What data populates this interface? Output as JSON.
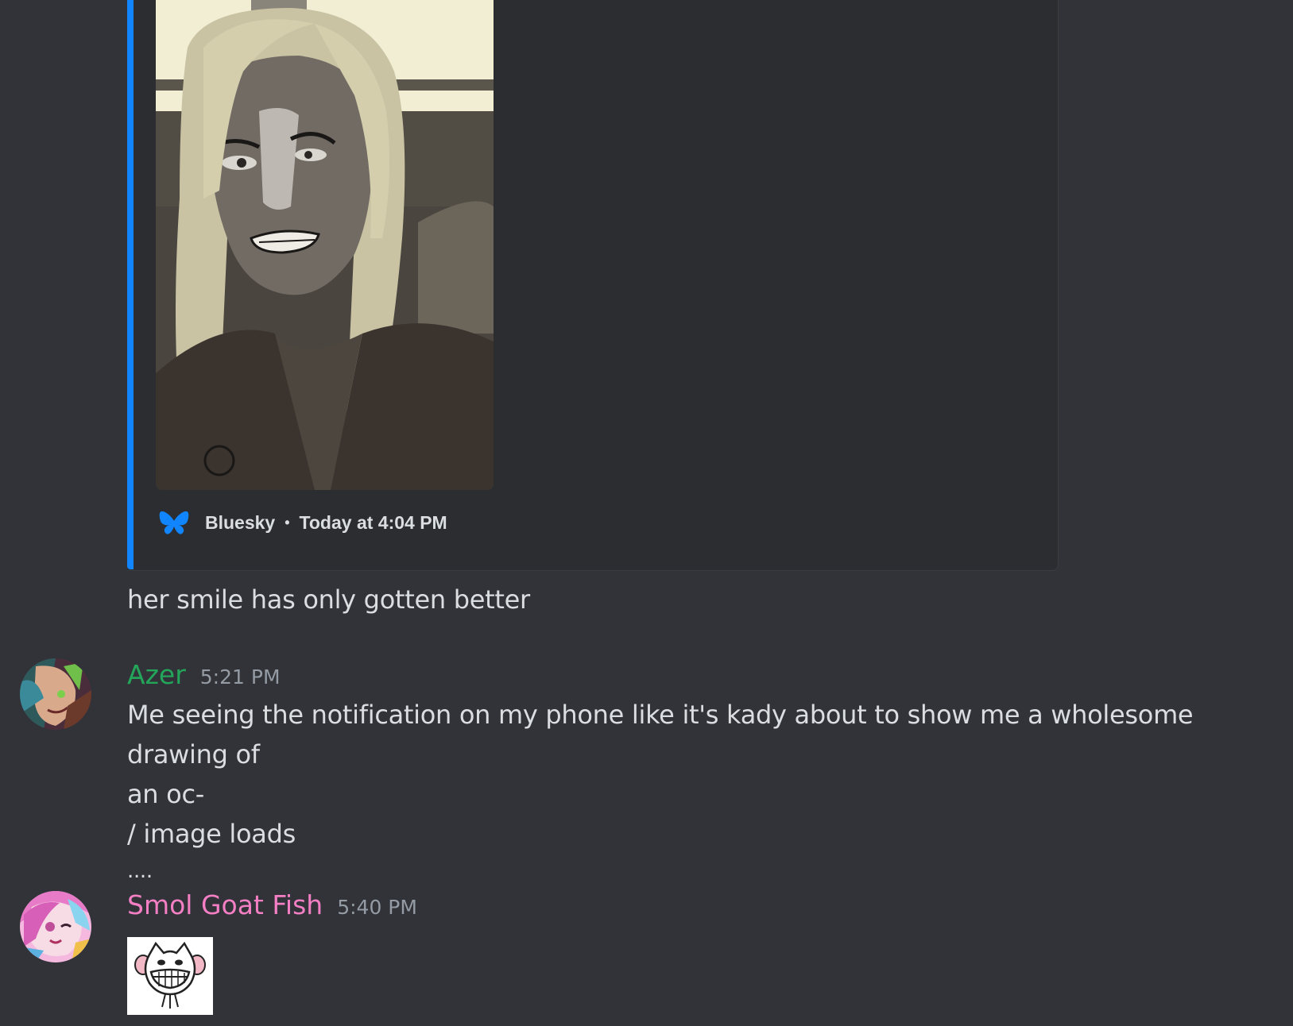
{
  "embed": {
    "provider": "Bluesky",
    "separator": "•",
    "timestamp": "Today at 4:04 PM",
    "accent_color": "#1185fe"
  },
  "messages": [
    {
      "text": "her smile has only gotten better"
    },
    {
      "author": "Azer",
      "author_color": "#23a55a",
      "timestamp": "5:21 PM",
      "lines": [
        "Me seeing the notification on my phone like it's kady about to show me a wholesome drawing of",
        "an oc-",
        "/ image loads",
        "...."
      ]
    },
    {
      "author": "Smol Goat Fish",
      "author_color": "#f47fc4",
      "timestamp": "5:40 PM"
    }
  ]
}
